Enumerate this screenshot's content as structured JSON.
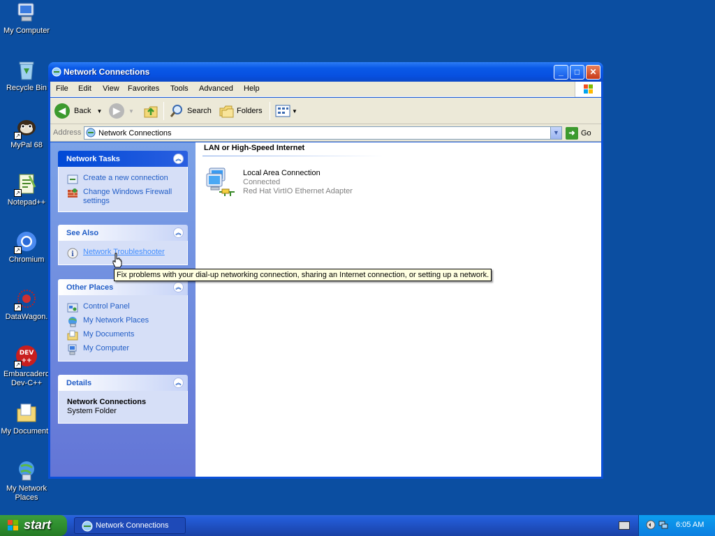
{
  "desktop": {
    "icons": [
      {
        "label": "My Computer",
        "icon": "my-computer-icon"
      },
      {
        "label": "Recycle Bin",
        "icon": "recycle-bin-icon"
      },
      {
        "label": "MyPal 68",
        "icon": "mypal-icon"
      },
      {
        "label": "Notepad++",
        "icon": "notepadpp-icon"
      },
      {
        "label": "Chromium",
        "icon": "chromium-icon"
      },
      {
        "label": "DataWagon.",
        "icon": "datawagon-icon"
      },
      {
        "label": "Embarcadero\nDev-C++",
        "icon": "devcpp-icon"
      },
      {
        "label": "My Documents",
        "icon": "my-documents-icon"
      },
      {
        "label": "My Network\nPlaces",
        "icon": "my-network-places-icon"
      }
    ]
  },
  "window": {
    "title": "Network Connections",
    "menu": [
      "File",
      "Edit",
      "View",
      "Favorites",
      "Tools",
      "Advanced",
      "Help"
    ],
    "toolbar": {
      "back": "Back",
      "search": "Search",
      "folders": "Folders"
    },
    "address": {
      "label": "Address",
      "value": "Network Connections",
      "go": "Go"
    },
    "network_tasks": {
      "title": "Network Tasks",
      "links": [
        "Create a new connection",
        "Change Windows Firewall settings"
      ]
    },
    "see_also": {
      "title": "See Also",
      "links": [
        "Network Troubleshooter"
      ]
    },
    "other_places": {
      "title": "Other Places",
      "links": [
        "Control Panel",
        "My Network Places",
        "My Documents",
        "My Computer"
      ]
    },
    "details": {
      "title": "Details",
      "name": "Network Connections",
      "type": "System Folder"
    },
    "group_header": "LAN or High-Speed Internet",
    "connection": {
      "name": "Local Area Connection",
      "status": "Connected",
      "adapter": "Red Hat VirtIO Ethernet Adapter"
    },
    "tooltip": "Fix problems with your dial-up networking connection, sharing an Internet connection, or setting up a network."
  },
  "taskbar": {
    "start": "start",
    "task": "Network Connections",
    "clock": "6:05 AM"
  }
}
